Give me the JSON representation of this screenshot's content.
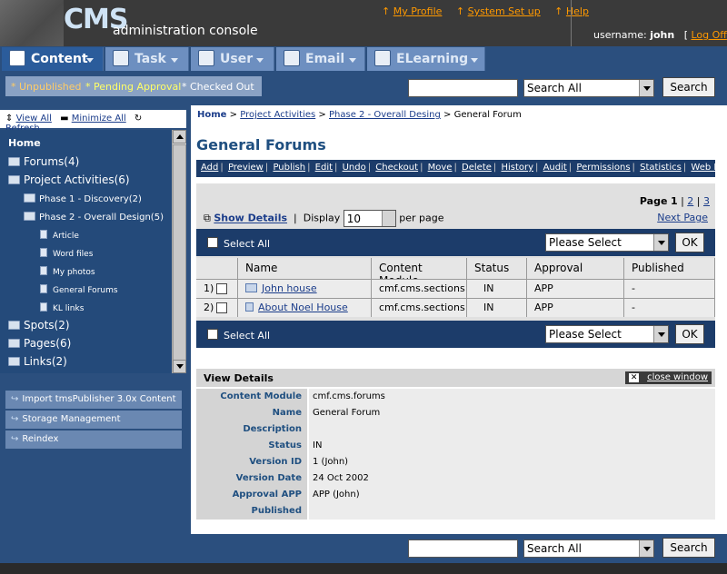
{
  "header": {
    "logo": "CMS",
    "subtitle": "administration console",
    "links": [
      "My Profile",
      "System Set up",
      "Help"
    ],
    "username_label": "username:",
    "username": "john",
    "logoff": "Log Off"
  },
  "tabs": [
    {
      "label": "Content",
      "icon": "content-icon"
    },
    {
      "label": "Task",
      "icon": "task-icon"
    },
    {
      "label": "User",
      "icon": "user-icon"
    },
    {
      "label": "Email",
      "icon": "email-icon"
    },
    {
      "label": "ELearning",
      "icon": "elearning-icon"
    }
  ],
  "filters": [
    "* Unpublished",
    "* Pending Approval",
    "* Checked Out"
  ],
  "search": {
    "select_value": "Search All",
    "button": "Search"
  },
  "tree_links": [
    "View All",
    "Minimize All",
    "Refresh"
  ],
  "tree": [
    "Home",
    "Forums(4)",
    "Project Activities(6)",
    "Phase 1 - Discovery(2)",
    "Phase 2 - Overall Design(5)",
    "Article",
    "Word files",
    "My photos",
    "General Forums",
    "KL links",
    "Spots(2)",
    "Pages(6)",
    "Links(2)"
  ],
  "left_actions": [
    "Import tmsPublisher 3.0x Content",
    "Storage Management",
    "Reindex"
  ],
  "breadcrumb": {
    "home": "Home",
    "path": [
      "Project Activities",
      "Phase 2 - Overall Desing"
    ],
    "current": "General Forum",
    "sep": ">"
  },
  "page_title": "General Forums",
  "actions": [
    "Add",
    "Preview",
    "Publish",
    "Edit",
    "Undo",
    "Checkout",
    "Move",
    "Delete",
    "History",
    "Audit",
    "Permissions",
    "Statistics",
    "Web Folder"
  ],
  "list": {
    "show_details": "Show Details",
    "display_label": "Display",
    "display_value": "10",
    "per_page": "per page",
    "page_label": "Page",
    "pages": [
      "1",
      "2",
      "3"
    ],
    "next_page": "Next Page",
    "select_all": "Select All",
    "please_select": "Please Select",
    "ok": "OK",
    "columns": [
      "Name",
      "Content Module",
      "Status",
      "Approval",
      "Published"
    ],
    "rows": [
      {
        "num": "1)",
        "name": "John house",
        "module": "cmf.cms.sections",
        "status": "IN",
        "approval": "APP",
        "published": "-"
      },
      {
        "num": "2)",
        "name": "About Noel House",
        "module": "cmf.cms.sections",
        "status": "IN",
        "approval": "APP",
        "published": "-"
      }
    ]
  },
  "details": {
    "title": "View Details",
    "close": "close window",
    "fields": [
      {
        "label": "Content Module",
        "value": "cmf.cms.forums"
      },
      {
        "label": "Name",
        "value": "General Forum"
      },
      {
        "label": "Description",
        "value": ""
      },
      {
        "label": "Status",
        "value": "IN"
      },
      {
        "label": "Version ID",
        "value": "1 (John)"
      },
      {
        "label": "Version Date",
        "value": "24 Oct 2002"
      },
      {
        "label": "Approval APP",
        "value": "APP (John)"
      },
      {
        "label": "Published",
        "value": ""
      }
    ]
  }
}
